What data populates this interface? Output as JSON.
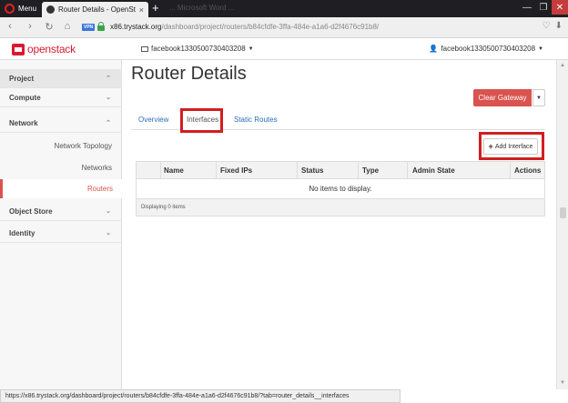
{
  "browser": {
    "menu_label": "Menu",
    "tab_title": "Router Details - OpenStack",
    "tab_close": "×",
    "new_tab": "+",
    "ghost_tabs": "... Microsoft Word ...",
    "vpn_label": "VPN",
    "url_host": "x86.trystack.org",
    "url_path": "/dashboard/project/routers/b84cfdfe-3ffa-484e-a1a6-d2f4676c91b8/",
    "nav_back": "‹",
    "nav_forward": "›",
    "nav_reload": "↻",
    "nav_home": "⌂",
    "win_min": "—",
    "win_max": "❐",
    "win_close": "✕"
  },
  "topnav": {
    "logo_text": "openstack",
    "project_select": "facebook1330500730403208",
    "user_menu": "facebook1330500730403208"
  },
  "sidebar": {
    "sections": [
      {
        "label": "Project",
        "chev": "^"
      },
      {
        "label": "Compute",
        "chev": "v"
      },
      {
        "label": "Network",
        "chev": "^"
      },
      {
        "label": "Object Store",
        "chev": "v"
      },
      {
        "label": "Identity",
        "chev": "v"
      }
    ],
    "network_items": [
      "Network Topology",
      "Networks",
      "Routers"
    ]
  },
  "main": {
    "title": "Router Details",
    "clear_gateway": "Clear Gateway",
    "tabs": [
      "Overview",
      "Interfaces",
      "Static Routes"
    ],
    "add_interface": "Add Interface",
    "add_icon": "+",
    "table": {
      "headers": [
        "Name",
        "Fixed IPs",
        "Status",
        "Type",
        "Admin State",
        "Actions"
      ],
      "empty_text": "No items to display.",
      "footer": "Displaying 0 items"
    }
  },
  "statusbar": {
    "text": "https://x86.trystack.org/dashboard/project/routers/b84cfdfe-3ffa-484e-a1a6-d2f4676c91b8/?tab=router_details__interfaces"
  },
  "colors": {
    "accent_red": "#d9534f",
    "link_blue": "#2a6ebb",
    "highlight_red": "#d21e1e"
  }
}
